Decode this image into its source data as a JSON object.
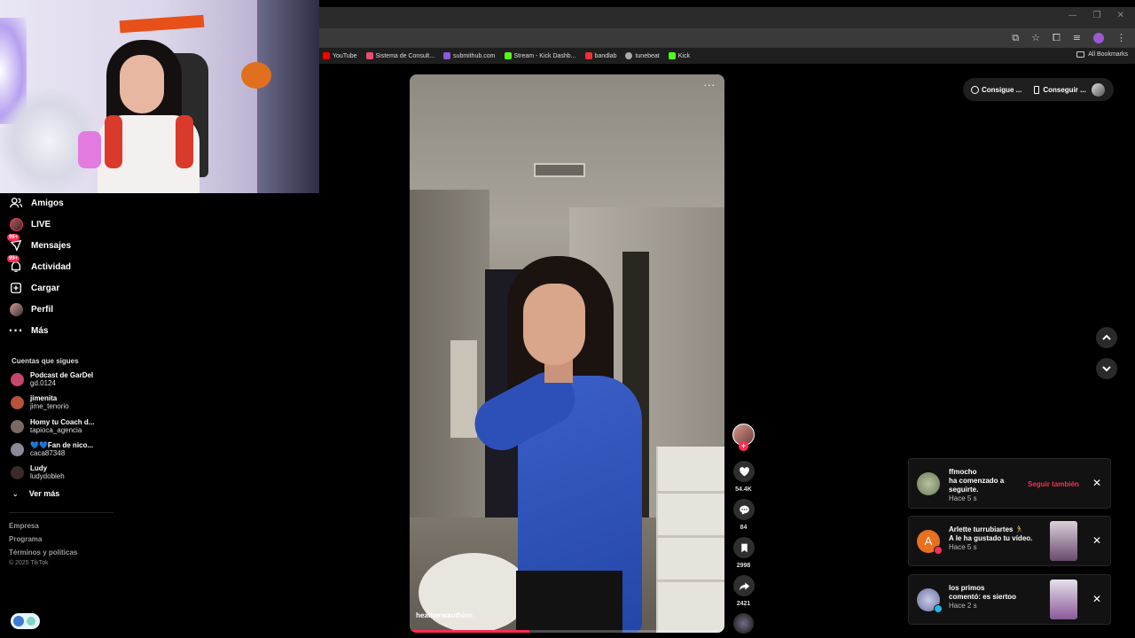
{
  "browser": {
    "bookmarks": [
      {
        "label": "YouTube",
        "color": "#ff0000"
      },
      {
        "label": "Sistema de Consult...",
        "color": "#e84d6b"
      },
      {
        "label": "submithub.com",
        "color": "#8a5bd6"
      },
      {
        "label": "Stream - Kick Dashb...",
        "color": "#53fc18"
      },
      {
        "label": "bandlab",
        "color": "#f03030"
      },
      {
        "label": "tunebeat",
        "color": "#aaaaaa"
      },
      {
        "label": "Kick",
        "color": "#53fc18"
      }
    ],
    "all_bookmarks": "All Bookmarks"
  },
  "nav": {
    "items": [
      {
        "label": "Amigos",
        "icon": "friends-icon"
      },
      {
        "label": "LIVE",
        "icon": "live-avatar-icon"
      },
      {
        "label": "Mensajes",
        "icon": "messages-icon",
        "badge": "99+"
      },
      {
        "label": "Actividad",
        "icon": "activity-icon",
        "badge": "99+"
      },
      {
        "label": "Cargar",
        "icon": "upload-icon"
      },
      {
        "label": "Perfil",
        "icon": "profile-avatar-icon"
      },
      {
        "label": "Más",
        "icon": "more-icon"
      }
    ]
  },
  "following": {
    "title": "Cuentas que sigues",
    "accounts": [
      {
        "name": "Podcast de GarDel",
        "handle": "gd.0124",
        "color": "#c5476b"
      },
      {
        "name": "jimenita",
        "handle": "jime_tenorio",
        "color": "#b5533c"
      },
      {
        "name": "Homy tu Coach d...",
        "handle": "tapioca_agencia",
        "color": "#7a6a62"
      },
      {
        "name": "💙💙Fan de nico...",
        "handle": "caca87348",
        "color": "#8a8a9a"
      },
      {
        "name": "Ludy",
        "handle": "ludydobleh",
        "color": "#3a2a28"
      }
    ],
    "see_more": "Ver más"
  },
  "footer": {
    "links": [
      "Empresa",
      "Programa",
      "Términos y políticas"
    ],
    "copyright": "© 2025 TikTok"
  },
  "video": {
    "author": "heatherwauthion_",
    "progress": 0.38,
    "likes": "54.4K",
    "comments": "84",
    "saves": "2998",
    "shares": "2421"
  },
  "top_pill": {
    "coins_label": "Consigue ...",
    "app_label": "Conseguir ..."
  },
  "notifications": [
    {
      "user": "ffmocho",
      "line2": "ha comenzado a",
      "line3": "seguirte.",
      "time": "Hace 5 s",
      "action": "Seguir también",
      "avatar_color": "#8aa080"
    },
    {
      "user": "Arlette turrubiartes 🏃",
      "line2": "A le ha gustado tu vídeo.",
      "line3": "",
      "time": "Hace 5 s",
      "avatar_letter": "A",
      "avatar_color": "#e8701e",
      "badge_color": "#fe2c55"
    },
    {
      "user": "los primos",
      "line2": "comentó: es siertoo",
      "line3": "",
      "time": "Hace 2 s",
      "avatar_color": "#8a90b8",
      "badge_color": "#20b8e8"
    }
  ]
}
